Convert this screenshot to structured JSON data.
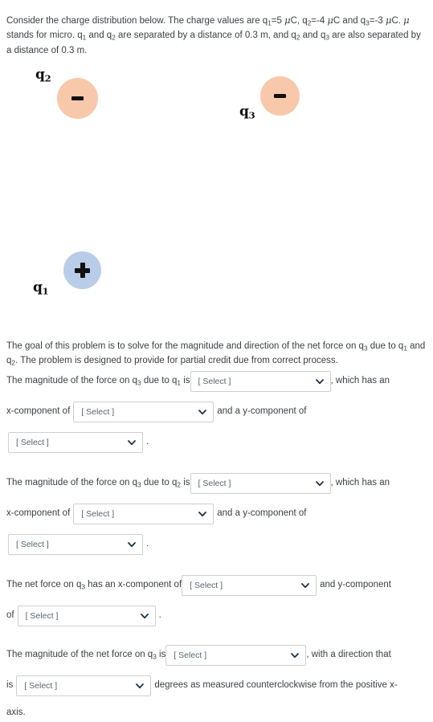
{
  "intro": {
    "part1": "Consider the charge distribution below.  The charge values are q",
    "sub1": "1",
    "part2": "=5 ",
    "mu1": "μ",
    "part3": "C, q",
    "sub2": "2",
    "part4": "=-4 ",
    "mu2": "μ",
    "part5": "C and q",
    "sub3": "3",
    "part6": "=-3 ",
    "mu3": "μ",
    "part7": "C. ",
    "mu4": "μ",
    "part8": " stands for micro. q",
    "sub4": "1",
    "part9": " and q",
    "sub5": "2",
    "part10": " are separated by a distance of 0.3 m, and q",
    "sub6": "2",
    "part11": " and q",
    "sub7": "3",
    "part12": " are also separated by a distance of 0.3 m."
  },
  "diagram": {
    "charges": [
      {
        "id": "q2",
        "label": "q",
        "subscript": "2",
        "sign": "minus",
        "color": "#f7c9aa"
      },
      {
        "id": "q3",
        "label": "q",
        "subscript": "3",
        "sign": "minus",
        "color": "#f7c9aa"
      },
      {
        "id": "q1",
        "label": "q",
        "subscript": "1",
        "sign": "plus",
        "color": "#b9cce8"
      }
    ]
  },
  "goal": {
    "part1": "The goal of this problem is to solve for the magnitude and direction of the net force on q",
    "sub1": "3",
    "part2": " due to q",
    "sub2": "1",
    "part3": " and q",
    "sub3": "2",
    "part4": ".   The problem is designed to provide for partial credit due from correct process."
  },
  "select_placeholder": "[ Select ]",
  "block_q1": {
    "lead": "The magnitude of the force on q",
    "lead_sub": "3",
    "lead_mid": " due to q",
    "lead_sub2": "1",
    "lead_end": " is",
    "after_select": ", which has an",
    "line2_pre": "x-component of",
    "line2_post": "and a y-component of",
    "line3_post": "."
  },
  "block_q2": {
    "lead": "The magnitude of the force on q",
    "lead_sub": "3",
    "lead_mid": " due to q",
    "lead_sub2": "2",
    "lead_end": " is",
    "after_select": ", which has an",
    "line2_pre": "x-component of",
    "line2_post": "and a y-component of",
    "line3_post": "."
  },
  "block_net": {
    "lead": "The net force on q",
    "lead_sub": "3",
    "lead_end": " has an x-component of",
    "after_select": "and y-component",
    "line2_pre": "of",
    "line2_post": "."
  },
  "block_mag": {
    "lead": "The magnitude of the net force on q",
    "lead_sub": "3",
    "lead_end": " is",
    "after_select": ", with a direction that",
    "line2_pre": "is",
    "line2_post": "degrees as measured counterclockwise from the positive x-",
    "line3": "axis."
  },
  "colors": {
    "text": "#3c4043",
    "negative_charge": "#f7c9aa",
    "positive_charge": "#b9cce8",
    "select_border": "#cfcfcf",
    "select_text": "#5a6472"
  }
}
